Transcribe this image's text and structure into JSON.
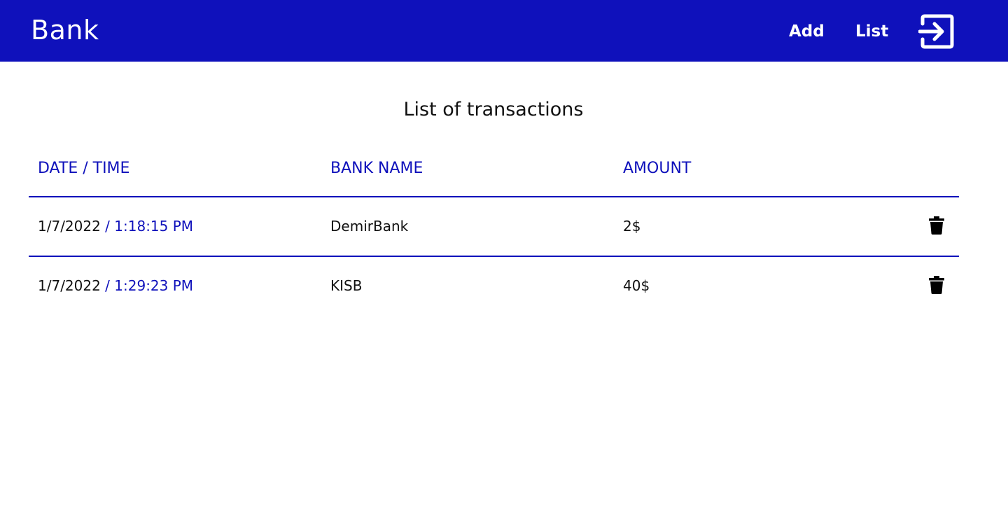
{
  "navbar": {
    "brand": "Bank",
    "links": [
      {
        "label": "Add"
      },
      {
        "label": "List"
      }
    ],
    "logout_icon": "logout-icon",
    "color": "#0f11bb"
  },
  "page": {
    "title": "List of transactions"
  },
  "table": {
    "headers": [
      "DATE / TIME",
      "BANK NAME",
      "AMOUNT"
    ],
    "rows": [
      {
        "date": "1/7/2022",
        "time": " / 1:18:15 PM",
        "bank": "DemirBank",
        "amount": "2$",
        "action_icon": "trash-icon"
      },
      {
        "date": "1/7/2022",
        "time": " / 1:29:23 PM",
        "bank": "KISB",
        "amount": "40$",
        "action_icon": "trash-icon"
      }
    ]
  }
}
